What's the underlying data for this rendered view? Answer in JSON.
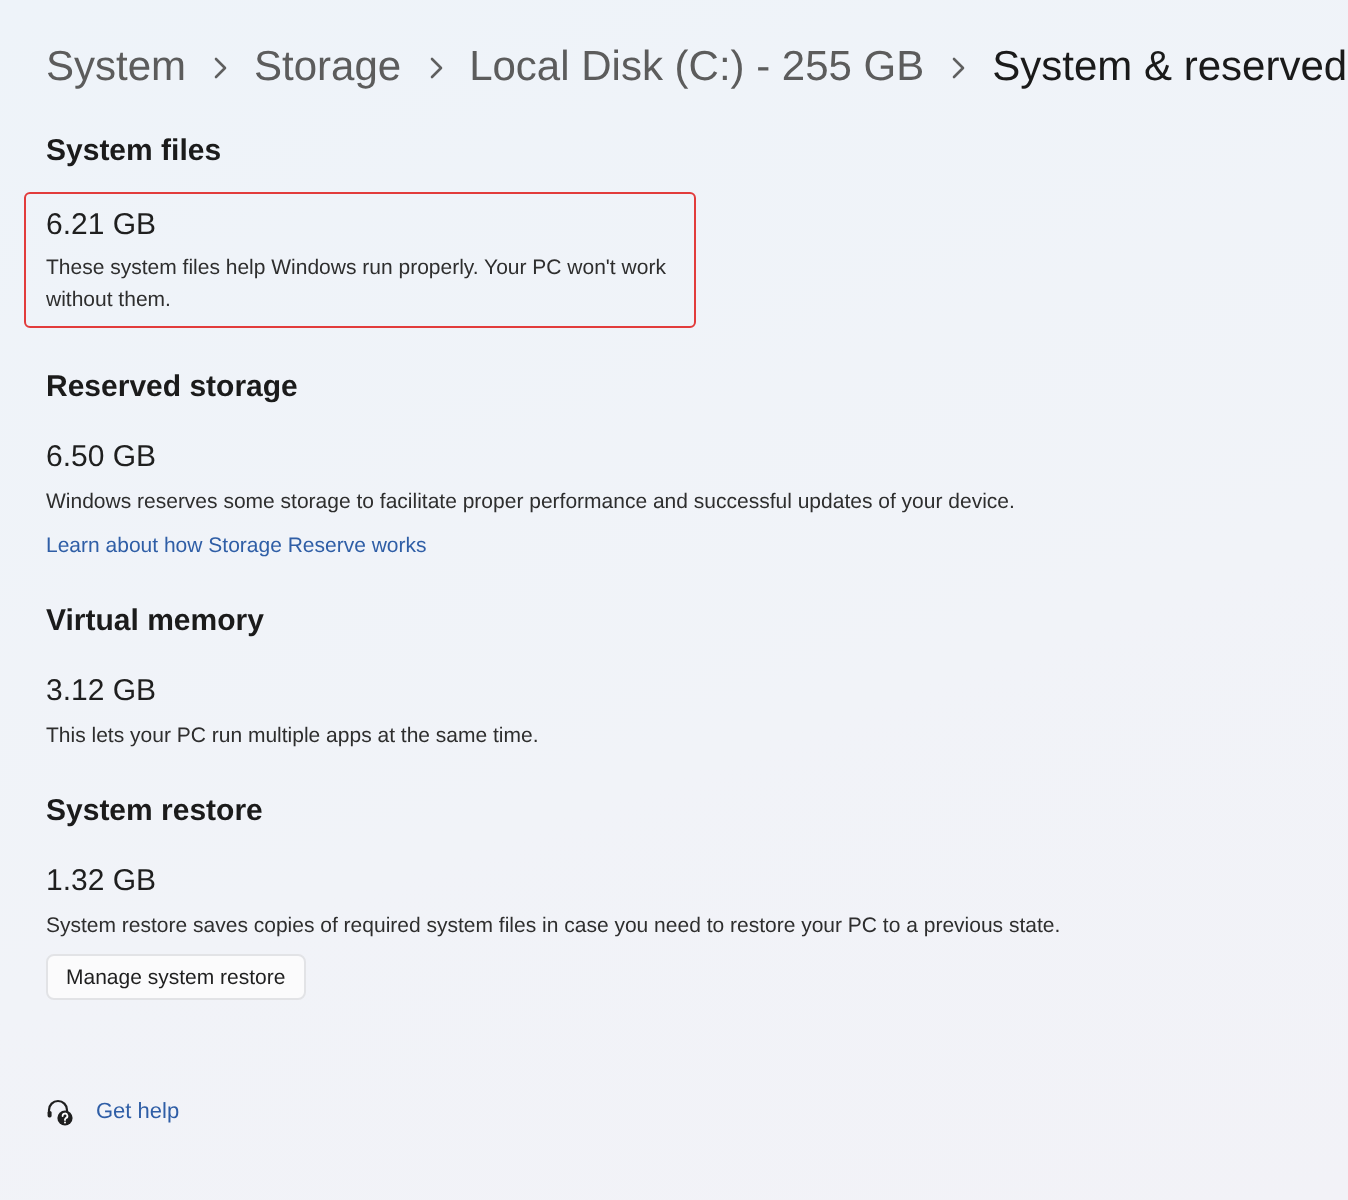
{
  "breadcrumb": [
    {
      "label": "System",
      "current": false
    },
    {
      "label": "Storage",
      "current": false
    },
    {
      "label": "Local Disk (C:) - 255 GB",
      "current": false
    },
    {
      "label": "System & reserved",
      "current": true
    }
  ],
  "sections": [
    {
      "title": "System files",
      "size": "6.21 GB",
      "description": "These system files help Windows run properly. Your PC won't work without them.",
      "highlighted": true
    },
    {
      "title": "Reserved storage",
      "size": "6.50 GB",
      "description": "Windows reserves some storage to facilitate proper performance and successful updates of your device.",
      "link": "Learn about how Storage Reserve works",
      "highlighted": false
    },
    {
      "title": "Virtual memory",
      "size": "3.12 GB",
      "description": "This lets your PC run multiple apps at the same time.",
      "highlighted": false
    },
    {
      "title": "System restore",
      "size": "1.32 GB",
      "description": "System restore saves copies of required system files in case you need to restore your PC to a previous state.",
      "button": "Manage system restore",
      "highlighted": false
    }
  ],
  "help": {
    "label": "Get help"
  }
}
